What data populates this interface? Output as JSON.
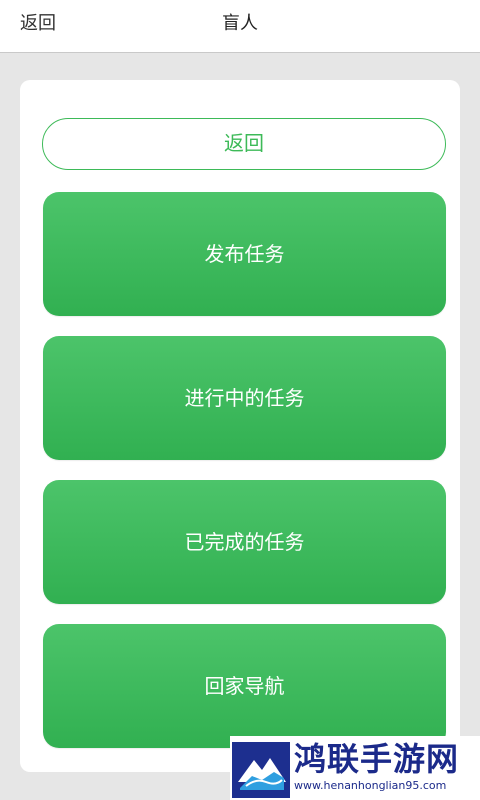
{
  "topbar": {
    "back_label": "返回",
    "title": "盲人"
  },
  "card": {
    "back_button_label": "返回",
    "buttons": [
      {
        "label": "发布任务"
      },
      {
        "label": "进行中的任务"
      },
      {
        "label": "已完成的任务"
      },
      {
        "label": "回家导航"
      }
    ]
  },
  "colors": {
    "accent_green": "#3dba58",
    "button_green_top": "#4cc46a",
    "button_green_bottom": "#31b051",
    "background": "#e6e6e6"
  },
  "watermark": {
    "name": "鸿联手游网",
    "url": "www.henanhonglian95.com"
  }
}
